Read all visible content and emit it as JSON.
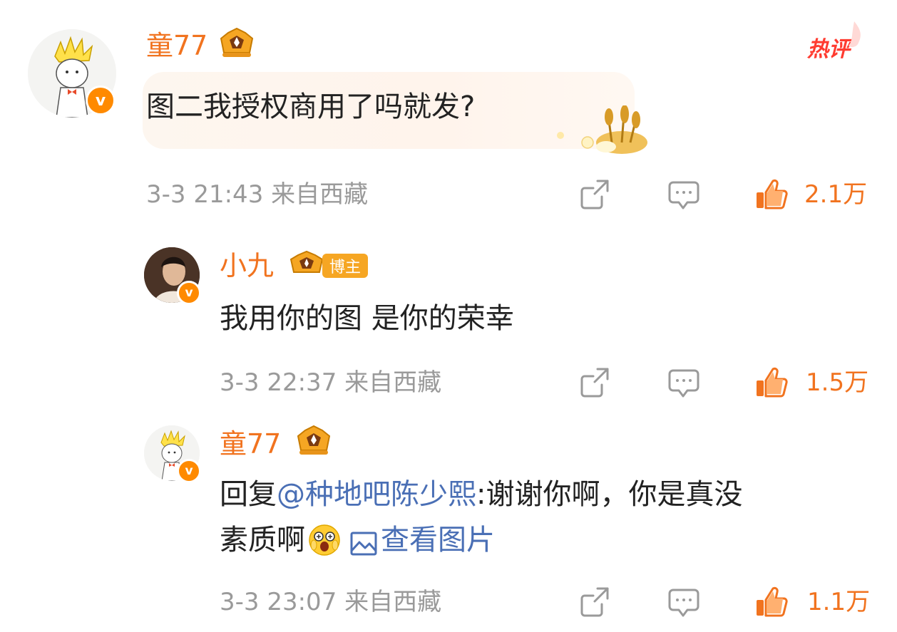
{
  "hot_tag": "热评",
  "comments": [
    {
      "user": "童77",
      "text": "图二我授权商用了吗就发?",
      "meta": "3-3 21:43 来自西藏",
      "likes": "2.1万"
    },
    {
      "user": "小九",
      "badge": "博主",
      "text": "我用你的图 是你的荣幸",
      "meta": "3-3 22:37 来自西藏",
      "likes": "1.5万"
    },
    {
      "user": "童77",
      "reply_prefix": "回复",
      "mention": "@种地吧陈少熙",
      "text_line1": ":谢谢你啊，你是真没",
      "text_line2": "素质啊",
      "view_image": "查看图片",
      "meta": "3-3 23:07 来自西藏",
      "likes": "1.1万"
    }
  ],
  "colors": {
    "accent": "#f1731f",
    "link": "#4a6fb5",
    "meta": "#9a9a9a",
    "hot": "#ff3b30"
  }
}
